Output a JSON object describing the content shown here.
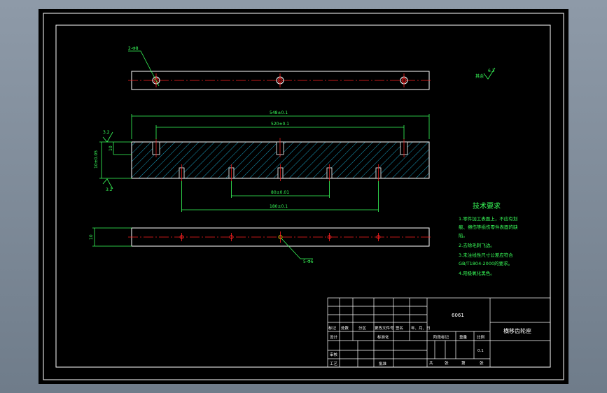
{
  "drawing": {
    "callouts": {
      "top_hole": "2-Φ8",
      "bottom_hole": "5-Φ6"
    },
    "dimensions": {
      "overall_length": "548±0.1",
      "hole_pitch_top": "520±0.1",
      "hole_pitch_mid": "80±0.01",
      "hole_pitch_bottom": "180±0.1",
      "depth_small": "10",
      "height_side": "10±0.05",
      "thickness_bottom": "10",
      "roughness_top": "3.2",
      "roughness_bottom": "3.2",
      "roughness_rest_label": "其余",
      "roughness_rest": "6.3"
    },
    "tech_requirements": {
      "title": "技术要求",
      "lines": [
        "1.零件加工表面上，不应有划",
        "痕、擦伤等损伤零件表面的缺",
        "陷。",
        "2.去除毛刺飞边。",
        "3.未注线性尺寸公差应符合",
        "GB/T1804-2000的要求。",
        "4.阳极氧化黑色。"
      ]
    },
    "title_block": {
      "material": "6061",
      "part_name": "横移齿轮座",
      "scale": "0.1",
      "scale_label": "比例",
      "weight_label": "重量",
      "stage_label": "阶段标记",
      "sheet_total": "共",
      "sheet_label": "张",
      "sheet_no": "第",
      "sheet_label2": "张",
      "row_mark": "标记",
      "row_count": "处数",
      "row_zone": "分区",
      "row_doc": "更改文件号",
      "row_sign": "签名",
      "row_date": "年、月、日",
      "design": "设计",
      "standard": "标准化",
      "review": "审核",
      "process": "工艺",
      "approve": "批准"
    }
  },
  "colors": {
    "background": "#000000",
    "frame": "#ffffff",
    "dimension": "#39ff5a",
    "centerline": "#ff2020",
    "hatch": "#1a9fc0",
    "text_title": "#f4f400"
  }
}
